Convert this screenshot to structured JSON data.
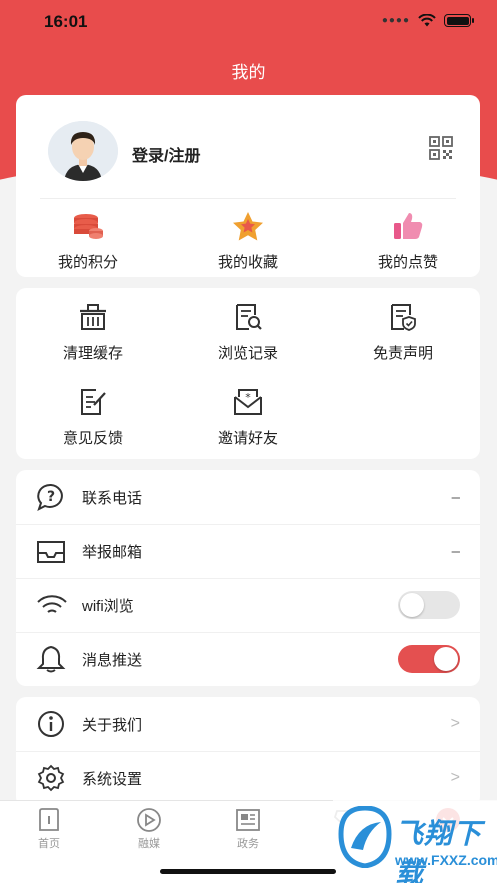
{
  "status": {
    "time": "16:01"
  },
  "header": {
    "title": "我的"
  },
  "profile": {
    "login_label": "登录/注册"
  },
  "stats": [
    {
      "label": "我的积分",
      "icon": "coins-icon"
    },
    {
      "label": "我的收藏",
      "icon": "star-icon"
    },
    {
      "label": "我的点赞",
      "icon": "thumbs-up-icon"
    }
  ],
  "tools": [
    {
      "label": "清理缓存",
      "icon": "trash-basket-icon"
    },
    {
      "label": "浏览记录",
      "icon": "history-doc-icon"
    },
    {
      "label": "免责声明",
      "icon": "shield-doc-icon"
    },
    {
      "label": "意见反馈",
      "icon": "feedback-edit-icon"
    },
    {
      "label": "邀请好友",
      "icon": "invite-envelope-icon"
    }
  ],
  "settings": [
    {
      "label": "联系电话",
      "value": "–",
      "icon": "question-bubble-icon"
    },
    {
      "label": "举报邮箱",
      "value": "–",
      "icon": "inbox-icon"
    },
    {
      "label": "wifi浏览",
      "toggle": false,
      "icon": "wifi-icon"
    },
    {
      "label": "消息推送",
      "toggle": true,
      "icon": "bell-icon"
    }
  ],
  "more": [
    {
      "label": "关于我们",
      "chevron": ">",
      "icon": "info-icon"
    },
    {
      "label": "系统设置",
      "chevron": ">",
      "icon": "gear-icon"
    }
  ],
  "tabs": [
    {
      "label": "首页",
      "icon": "home-icon"
    },
    {
      "label": "融媒",
      "icon": "play-icon"
    },
    {
      "label": "政务",
      "icon": "news-icon"
    },
    {
      "label": "",
      "icon": "diamond-icon"
    },
    {
      "label": "",
      "icon": "profile-icon"
    }
  ],
  "watermark": {
    "text": "飞翔下载",
    "url": "www.FXXZ.com"
  },
  "colors": {
    "accent": "#e84c4c",
    "toggle_on": "#e45050",
    "watermark": "#2a8fd8"
  }
}
